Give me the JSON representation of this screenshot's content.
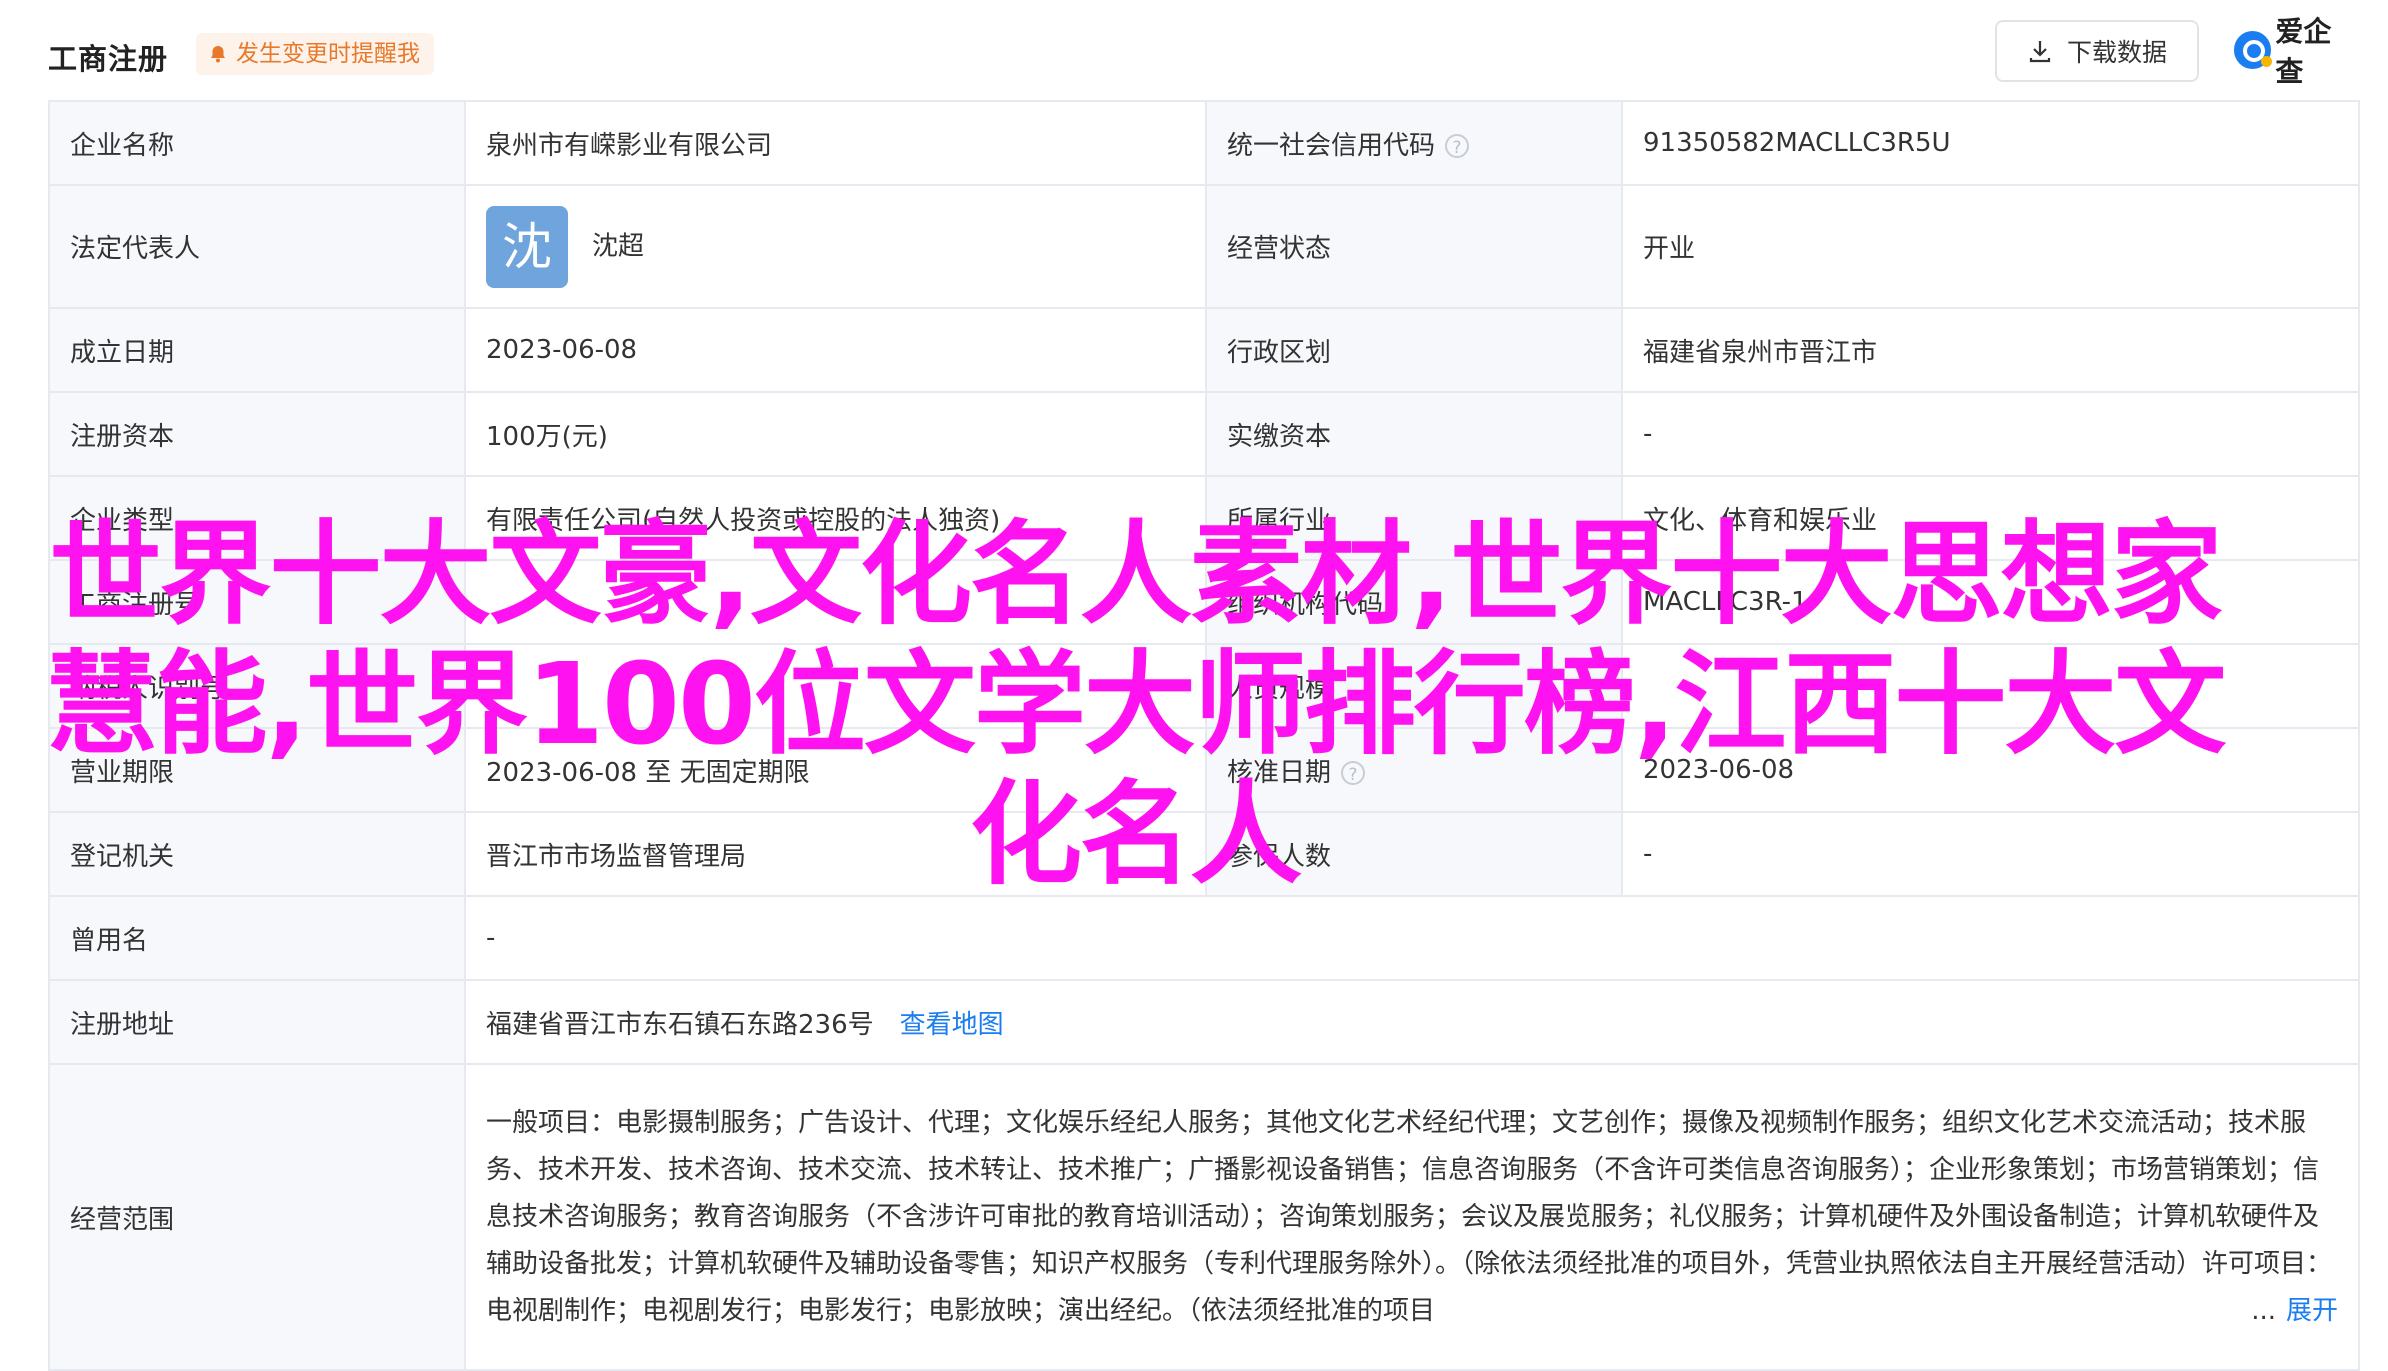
{
  "header": {
    "title": "工商注册",
    "alert_tag": "发生变更时提醒我",
    "download_label": "下载数据",
    "logo_text": "爱企查"
  },
  "rows": {
    "company_name": {
      "label": "企业名称",
      "value": "泉州市有嵘影业有限公司"
    },
    "credit_code": {
      "label": "统一社会信用代码",
      "value": "91350582MACLLC3R5U"
    },
    "legal_rep": {
      "label": "法定代表人",
      "avatar_char": "沈",
      "value": "沈超"
    },
    "status": {
      "label": "经营状态",
      "value": "开业"
    },
    "founded": {
      "label": "成立日期",
      "value": "2023-06-08"
    },
    "region": {
      "label": "行政区划",
      "value": "福建省泉州市晋江市"
    },
    "capital": {
      "label": "注册资本",
      "value": "100万(元)"
    },
    "paid_capital": {
      "label": "实缴资本",
      "value": "-"
    },
    "type": {
      "label": "企业类型",
      "value": "有限责任公司(自然人投资或控股的法人独资)"
    },
    "industry": {
      "label": "所属行业",
      "value": "文化、体育和娱乐业"
    },
    "reg_no": {
      "label": "工商注册号",
      "value": ""
    },
    "org_code": {
      "label": "组织机构代码",
      "value": "MACLLC3R-1"
    },
    "taxpayer": {
      "label": "纳税人识别号",
      "value": ""
    },
    "staff": {
      "label": "人员规模",
      "value": ""
    },
    "term": {
      "label": "营业期限",
      "value": "2023-06-08 至 无固定期限"
    },
    "approve_date": {
      "label": "核准日期",
      "value": "2023-06-08"
    },
    "authority": {
      "label": "登记机关",
      "value": "晋江市市场监督管理局"
    },
    "insured": {
      "label": "参保人数",
      "value": "-"
    },
    "former_name": {
      "label": "曾用名",
      "value": "-"
    },
    "address": {
      "label": "注册地址",
      "value": "福建省晋江市东石镇石东路236号",
      "link": "查看地图"
    },
    "scope": {
      "label": "经营范围",
      "value": "一般项目：电影摄制服务；广告设计、代理；文化娱乐经纪人服务；其他文化艺术经纪代理；文艺创作；摄像及视频制作服务；组织文化艺术交流活动；技术服务、技术开发、技术咨询、技术交流、技术转让、技术推广；广播影视设备销售；信息咨询服务（不含许可类信息咨询服务）；企业形象策划；市场营销策划；信息技术咨询服务；教育咨询服务（不含涉许可审批的教育培训活动）；咨询策划服务；会议及展览服务；礼仪服务；计算机硬件及外围设备制造；计算机软硬件及辅助设备批发；计算机软硬件及辅助设备零售；知识产权服务（专利代理服务除外）。（除依法须经批准的项目外，凭营业执照依法自主开展经营活动）许可项目：电视剧制作；电视剧发行；电影发行；电影放映；演出经纪。（依法须经批准的项目",
      "ellipsis": "...",
      "expand": "展开"
    }
  },
  "overlay_text": "世界十大文豪,文化名人素材,世界十大思想家 慧能,世界100位文学大师排行榜,江西十大文化名人",
  "colors": {
    "accent": "#1a7ef0",
    "overlay": "#ff12f0",
    "alert": "#e8792a"
  }
}
